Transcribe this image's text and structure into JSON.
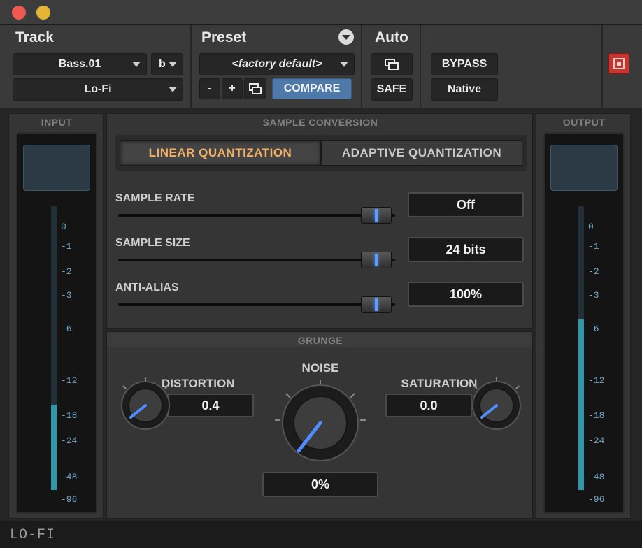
{
  "header": {
    "track_label": "Track",
    "preset_label": "Preset",
    "auto_label": "Auto",
    "track_name": "Bass.01",
    "track_channel": "b",
    "plugin_name": "Lo-Fi",
    "preset_name": "<factory default>",
    "minus_label": "-",
    "plus_label": "+",
    "compare_label": "COMPARE",
    "safe_label": "SAFE",
    "bypass_label": "BYPASS",
    "native_label": "Native"
  },
  "input": {
    "title": "INPUT",
    "level": 0.3,
    "ticks": [
      "0",
      "-1",
      "-2",
      "-3",
      "-6",
      "-12",
      "-18",
      "-24",
      "-48",
      "-96"
    ]
  },
  "output": {
    "title": "OUTPUT",
    "level": 0.6,
    "ticks": [
      "0",
      "-1",
      "-2",
      "-3",
      "-6",
      "-12",
      "-18",
      "-24",
      "-48",
      "-96"
    ]
  },
  "sample_conversion": {
    "title": "SAMPLE CONVERSION",
    "mode_linear": "LINEAR QUANTIZATION",
    "mode_adaptive": "ADAPTIVE QUANTIZATION",
    "selected_mode": "LINEAR QUANTIZATION",
    "sample_rate": {
      "label": "SAMPLE RATE",
      "value": "Off",
      "position": 0.96
    },
    "sample_size": {
      "label": "SAMPLE SIZE",
      "value": "24 bits",
      "position": 0.96
    },
    "anti_alias": {
      "label": "ANTI-ALIAS",
      "value": "100%",
      "position": 0.96
    }
  },
  "grunge": {
    "title": "GRUNGE",
    "distortion": {
      "label": "DISTORTION",
      "value": "0.4"
    },
    "noise": {
      "label": "NOISE",
      "value": "0%"
    },
    "saturation": {
      "label": "SATURATION",
      "value": "0.0"
    }
  },
  "footer": {
    "title": "LO-FI"
  },
  "colors": {
    "accent_blue": "#4f79a8",
    "active_mode": "#f2b068",
    "meter": "#2f98a6",
    "knob_indicator": "#3f85ff"
  }
}
